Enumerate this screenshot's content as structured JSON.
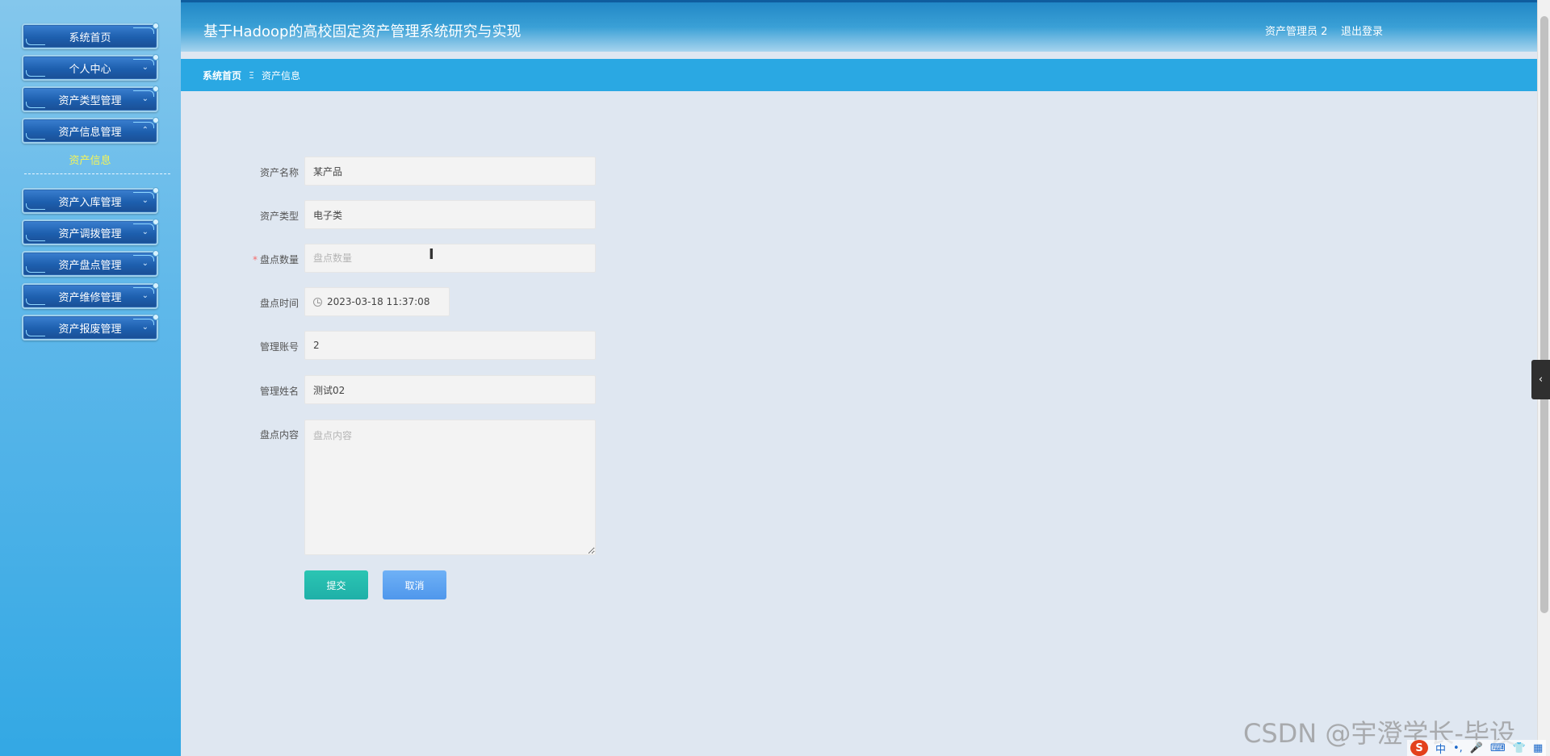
{
  "header": {
    "title": "基于Hadoop的高校固定资产管理系统研究与实现",
    "user": "资产管理员 2",
    "logout": "退出登录"
  },
  "sidebar": {
    "items": [
      {
        "label": "系统首页"
      },
      {
        "label": "个人中心"
      },
      {
        "label": "资产类型管理"
      },
      {
        "label": "资产信息管理"
      },
      {
        "label": "资产入库管理"
      },
      {
        "label": "资产调拨管理"
      },
      {
        "label": "资产盘点管理"
      },
      {
        "label": "资产维修管理"
      },
      {
        "label": "资产报废管理"
      }
    ],
    "submenu_label": "资产信息"
  },
  "breadcrumb": {
    "home": "系统首页",
    "separator": "Ξ",
    "current": "资产信息"
  },
  "form": {
    "asset_name": {
      "label": "资产名称",
      "value": "某产品"
    },
    "asset_type": {
      "label": "资产类型",
      "value": "电子类"
    },
    "count_qty": {
      "label": "盘点数量",
      "placeholder": "盘点数量",
      "required_mark": "*"
    },
    "count_time": {
      "label": "盘点时间",
      "value": "2023-03-18 11:37:08"
    },
    "manager_account": {
      "label": "管理账号",
      "value": "2"
    },
    "manager_name": {
      "label": "管理姓名",
      "value": "测试02"
    },
    "count_content": {
      "label": "盘点内容",
      "placeholder": "盘点内容"
    },
    "submit": "提交",
    "cancel": "取消"
  },
  "side_tab_glyph": "‹",
  "watermark": "CSDN @宇澄学长-毕设",
  "ime": {
    "logo": "S",
    "items": [
      "中",
      "•,",
      "🎤",
      "⌨",
      "👕",
      "▦"
    ]
  }
}
